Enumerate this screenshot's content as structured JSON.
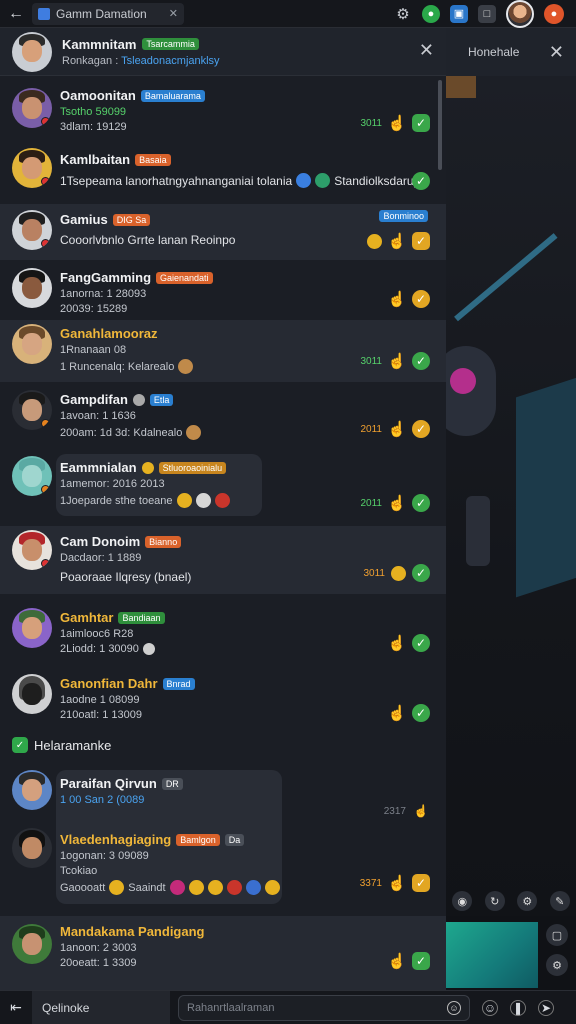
{
  "topbar": {
    "back_icon": "back-arrow-icon",
    "tab_title": "Gamm Damation",
    "icons": [
      "gear-icon",
      "green-app-icon",
      "blue-app-icon",
      "doc-icon",
      "user-avatar",
      "orange-app-icon"
    ]
  },
  "panel": {
    "header": {
      "name": "Kammnitam",
      "badge": "Tsarcammia",
      "sub_label": "Ronkagan :",
      "sub_link": "Tsleadonacmjanklsy"
    },
    "rows": [
      {
        "name": "Oamoonitan",
        "badge": "Bamaluarama",
        "line1": "Tsotho 59099",
        "line2": "3dlam: 19129",
        "time": "3011"
      },
      {
        "name": "Kamlbaitan",
        "badge": "Basaia",
        "message": "1Tsepeama lanorhatngyahnanganiai tolania",
        "side_text": "Standiolksdaruy"
      },
      {
        "name": "Gamius",
        "badge": "DIG Sa",
        "message": "Cooorlvbnlo Grrte lanan Reoinpo",
        "tag": "Bonminoo"
      },
      {
        "name": "FangGamming",
        "badge": "Gaienandati",
        "line1": "1anorna: 1 28093",
        "line2": "20039: 15289"
      },
      {
        "name": "Ganahlamooraz",
        "line1": "1Rnanaan 08",
        "line2": "1 Runcenalq: Kelarealo",
        "time": "3011"
      },
      {
        "name": "Gampdifan",
        "badge": "Etla",
        "line1": "1avoan: 1 1636",
        "line2": "200am: 1d 3d: Kdalnealo",
        "time": "2011"
      },
      {
        "name": "Eammnialan",
        "badge": "Stluoroaoinialu",
        "line1": "1amemor: 2016 2013",
        "line2": "1Joeparde sthe toeane",
        "time": "2011"
      },
      {
        "name": "Cam Donoim",
        "badge": "Bianno",
        "line1": "Dacdaor: 1 1889",
        "message": "Poaoraae Ilqresy (bnael)",
        "time": "3011"
      },
      {
        "name": "Gamhtar",
        "badge": "Bandiaan",
        "line1": "1aimlooc6 R28",
        "line2": "2Liodd: 1 30090",
        "time": ""
      },
      {
        "name": "Ganonfian Dahr",
        "badge": "Bnrad",
        "line1": "1aodne 1 08099",
        "line2": "210oatl: 1 13009"
      }
    ],
    "section_label": "Helaramanke",
    "bubble_rows": [
      {
        "name": "Paraifan Qirvun",
        "badge": "DR",
        "line1": "1 00 San 2 (0089",
        "time": "2317"
      },
      {
        "name": "Vlaedenhagiaging",
        "badge": "Bamlgon",
        "badge2": "Da",
        "line1": "1ogonan: 3 09089",
        "line2": "Tcokiao",
        "line3": "Gaoooatt",
        "line3b": "Saaindt",
        "time": "3371"
      },
      {
        "name": "Mandakama Pandigang",
        "line1": "1anoon: 2 3003",
        "line2": "20oeatt: 1 3309",
        "time": ""
      }
    ]
  },
  "side": {
    "header_label": "Honehale",
    "close_icon": "close-icon"
  },
  "bottombar": {
    "chip_label": "Qelinoke",
    "input_placeholder": "Rahanrtlaalraman",
    "tools": [
      "emoji-icon",
      "smiley-icon",
      "pause-icon",
      "send-icon"
    ]
  }
}
